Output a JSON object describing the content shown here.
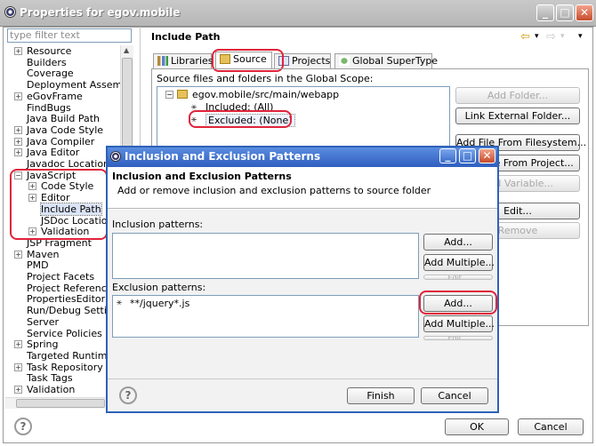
{
  "window": {
    "title": "Properties for egov.mobile",
    "min": "_",
    "max": "□",
    "close": "✕"
  },
  "filter": {
    "placeholder": "type filter text"
  },
  "tree": [
    {
      "label": "Resource",
      "indent": 0,
      "expander": "+"
    },
    {
      "label": "Builders",
      "indent": 0,
      "expander": ""
    },
    {
      "label": "Coverage",
      "indent": 0,
      "expander": ""
    },
    {
      "label": "Deployment Assembly",
      "indent": 0,
      "expander": ""
    },
    {
      "label": "eGovFrame",
      "indent": 0,
      "expander": "+"
    },
    {
      "label": "FindBugs",
      "indent": 0,
      "expander": ""
    },
    {
      "label": "Java Build Path",
      "indent": 0,
      "expander": ""
    },
    {
      "label": "Java Code Style",
      "indent": 0,
      "expander": "+"
    },
    {
      "label": "Java Compiler",
      "indent": 0,
      "expander": "+"
    },
    {
      "label": "Java Editor",
      "indent": 0,
      "expander": "+"
    },
    {
      "label": "Javadoc Location",
      "indent": 0,
      "expander": ""
    },
    {
      "label": "JavaScript",
      "indent": 0,
      "expander": "−"
    },
    {
      "label": "Code Style",
      "indent": 1,
      "expander": "+"
    },
    {
      "label": "Editor",
      "indent": 1,
      "expander": "+"
    },
    {
      "label": "Include Path",
      "indent": 1,
      "expander": "",
      "selected": true
    },
    {
      "label": "JSDoc Location",
      "indent": 1,
      "expander": ""
    },
    {
      "label": "Validation",
      "indent": 1,
      "expander": "+"
    },
    {
      "label": "JSP Fragment",
      "indent": 0,
      "expander": ""
    },
    {
      "label": "Maven",
      "indent": 0,
      "expander": "+"
    },
    {
      "label": "PMD",
      "indent": 0,
      "expander": ""
    },
    {
      "label": "Project Facets",
      "indent": 0,
      "expander": ""
    },
    {
      "label": "Project References",
      "indent": 0,
      "expander": ""
    },
    {
      "label": "PropertiesEditor",
      "indent": 0,
      "expander": ""
    },
    {
      "label": "Run/Debug Settings",
      "indent": 0,
      "expander": ""
    },
    {
      "label": "Server",
      "indent": 0,
      "expander": ""
    },
    {
      "label": "Service Policies",
      "indent": 0,
      "expander": ""
    },
    {
      "label": "Spring",
      "indent": 0,
      "expander": "+"
    },
    {
      "label": "Targeted Runtimes",
      "indent": 0,
      "expander": ""
    },
    {
      "label": "Task Repository",
      "indent": 0,
      "expander": "+"
    },
    {
      "label": "Task Tags",
      "indent": 0,
      "expander": ""
    },
    {
      "label": "Validation",
      "indent": 0,
      "expander": "+"
    }
  ],
  "page": {
    "title": "Include Path",
    "nav_back": "⇦",
    "nav_fwd": "⇨",
    "nav_menu": "▾"
  },
  "tabs": [
    "Libraries",
    "Source",
    "Projects",
    "Global SuperType"
  ],
  "source": {
    "caption": "Source files and folders in the Global Scope:",
    "folder": "egov.mobile/src/main/webapp",
    "included": "Included: (All)",
    "excluded": "Excluded: (None)"
  },
  "right_buttons": {
    "add_folder": "Add Folder...",
    "link_external": "Link External Folder...",
    "add_file": "Add File From Filesystem...",
    "add_from_project": "Add File From Project...",
    "add_variable": "Add Variable...",
    "edit": "Edit...",
    "remove": "Remove"
  },
  "dialog": {
    "title": "Inclusion and Exclusion Patterns",
    "heading": "Inclusion and Exclusion Patterns",
    "description": "Add or remove inclusion and exclusion patterns to source folder",
    "inclusion_label": "Inclusion patterns:",
    "exclusion_label": "Exclusion patterns:",
    "exclusion_items": [
      "**/jquery*.js"
    ],
    "add": "Add...",
    "add_multiple": "Add Multiple...",
    "edit_partial": "Edit...",
    "finish": "Finish",
    "cancel": "Cancel"
  },
  "footer": {
    "ok": "OK",
    "cancel": "Cancel"
  },
  "colors": {
    "highlight": "#e0243a",
    "dialog_border": "#2e62b8"
  }
}
